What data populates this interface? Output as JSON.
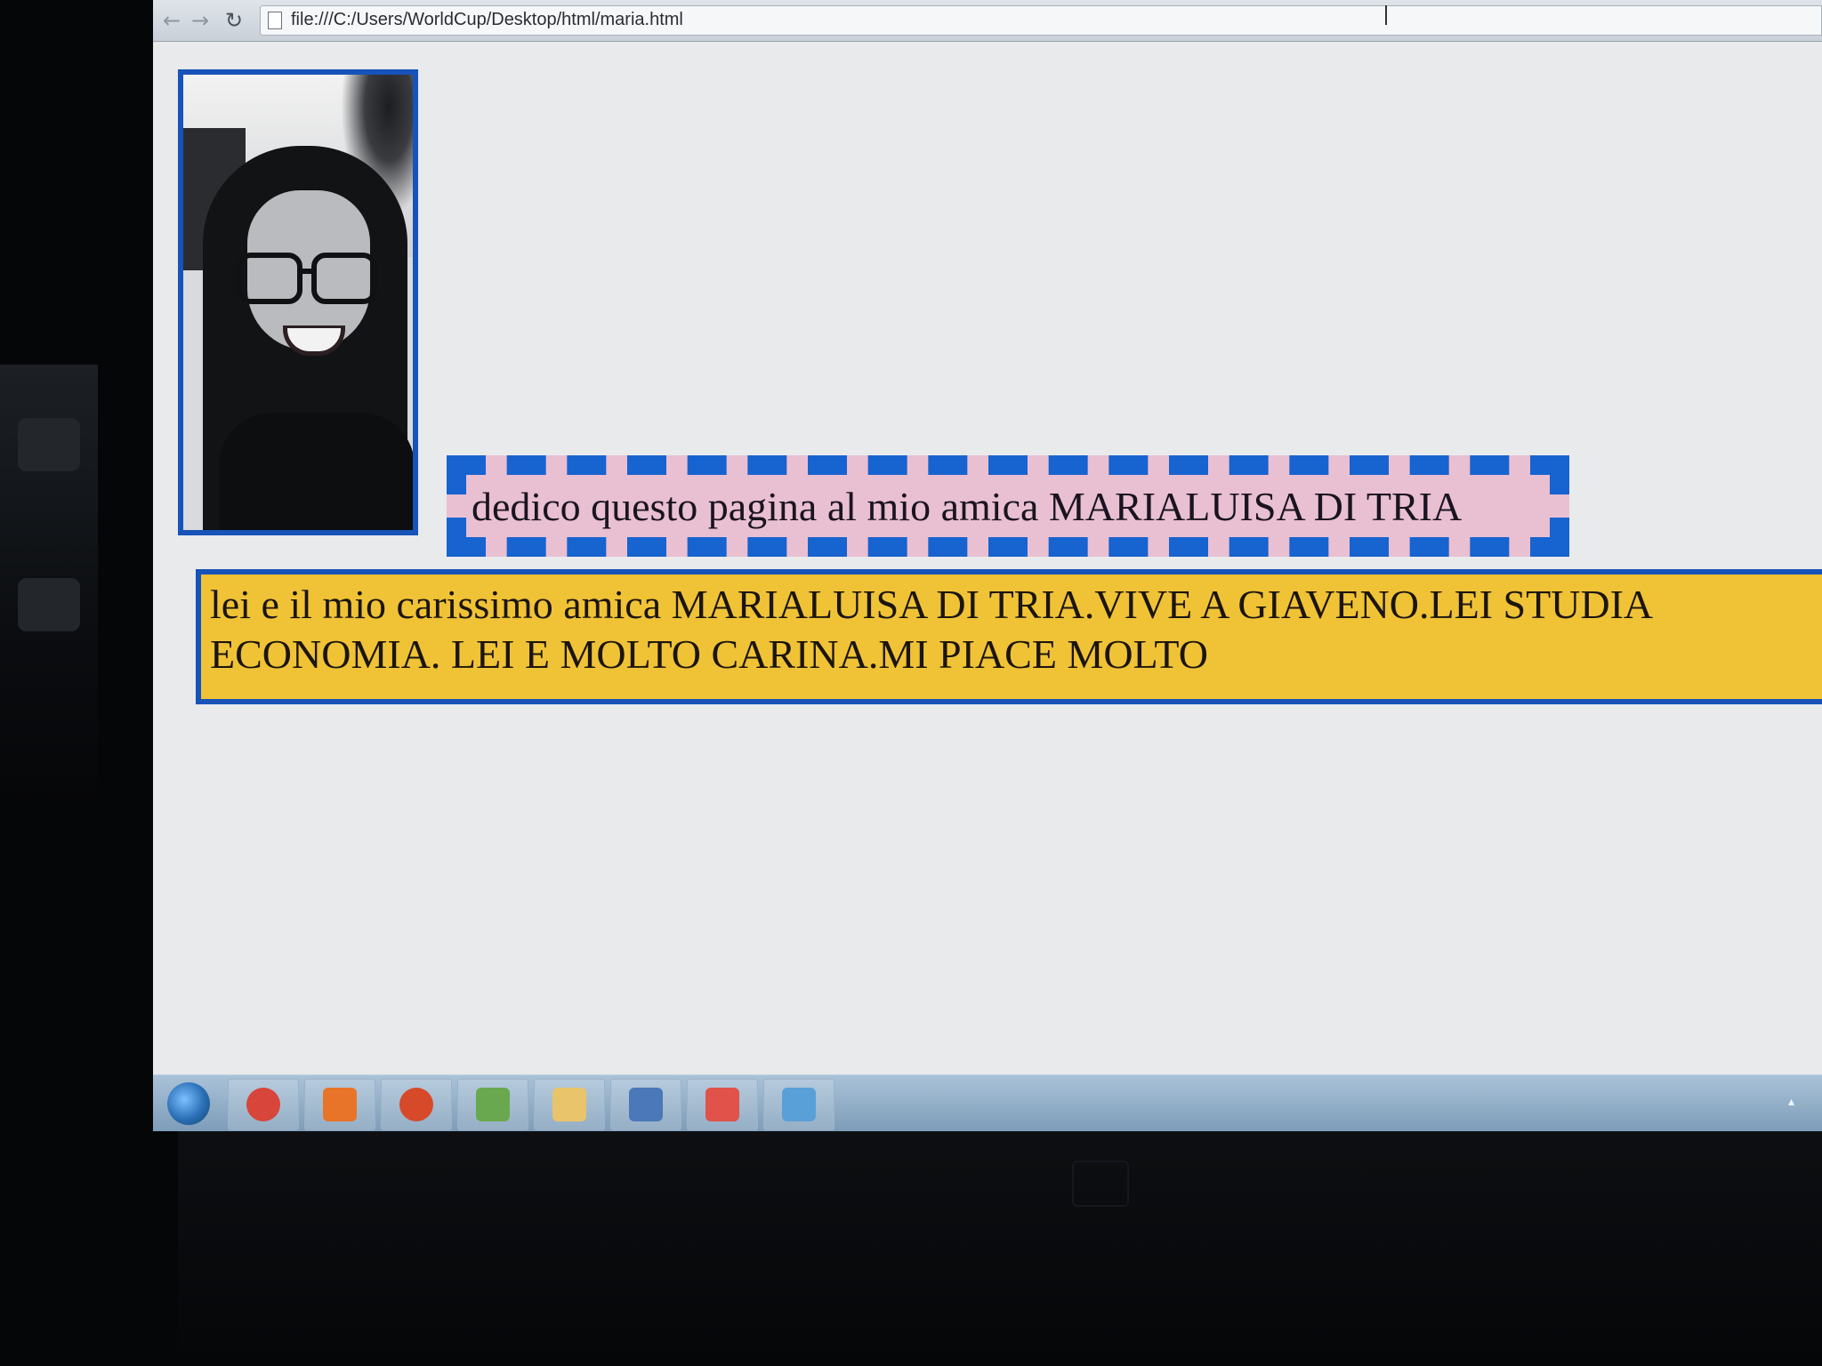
{
  "browser": {
    "url": "file:///C:/Users/WorldCup/Desktop/html/maria.html"
  },
  "page": {
    "dedication": "dedico questo pagina al mio amica MARIALUISA DI TRIA",
    "bio": "lei e il mio carissimo amica MARIALUISA DI TRIA.VIVE A GIAVENO.LEI STUDIA ECONOMIA. LEI E MOLTO CARINA.MI PIACE MOLTO"
  },
  "taskbar": {
    "items": [
      {
        "icon": "chrome-icon",
        "color": "#d8453a"
      },
      {
        "icon": "media-player-icon",
        "color": "#e8742a"
      },
      {
        "icon": "media-center-icon",
        "color": "#d64a2a"
      },
      {
        "icon": "paint-icon",
        "color": "#6aa84f"
      },
      {
        "icon": "folder-icon",
        "color": "#e9c46a"
      },
      {
        "icon": "screen-tool-icon",
        "color": "#4a78b8"
      },
      {
        "icon": "chart-app-icon",
        "color": "#e0524a"
      },
      {
        "icon": "network-icon",
        "color": "#5aa0d8"
      }
    ]
  },
  "colors": {
    "border_blue": "#1753b8",
    "dedication_bg": "#e9bfd2",
    "bio_bg": "#f0c236"
  }
}
